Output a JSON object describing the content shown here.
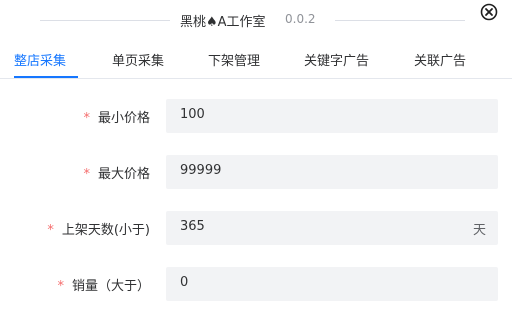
{
  "window": {
    "title": "黑桃♠A工作室",
    "version": "0.0.2",
    "close_icon": "close-circle-icon"
  },
  "tabs": [
    {
      "label": "整店采集",
      "active": true
    },
    {
      "label": "单页采集",
      "active": false
    },
    {
      "label": "下架管理",
      "active": false
    },
    {
      "label": "关键字广告",
      "active": false
    },
    {
      "label": "关联广告",
      "active": false
    }
  ],
  "form": {
    "required_mark": "*",
    "fields": [
      {
        "label": "最小价格",
        "value": "100"
      },
      {
        "label": "最大价格",
        "value": "99999"
      },
      {
        "label": "上架天数(小于)",
        "value": "365",
        "suffix": "天"
      },
      {
        "label": "销量（大于）",
        "value": "0"
      }
    ]
  },
  "colors": {
    "accent": "#1677ff",
    "required": "#f56c6c",
    "field_bg": "#f2f3f5"
  }
}
